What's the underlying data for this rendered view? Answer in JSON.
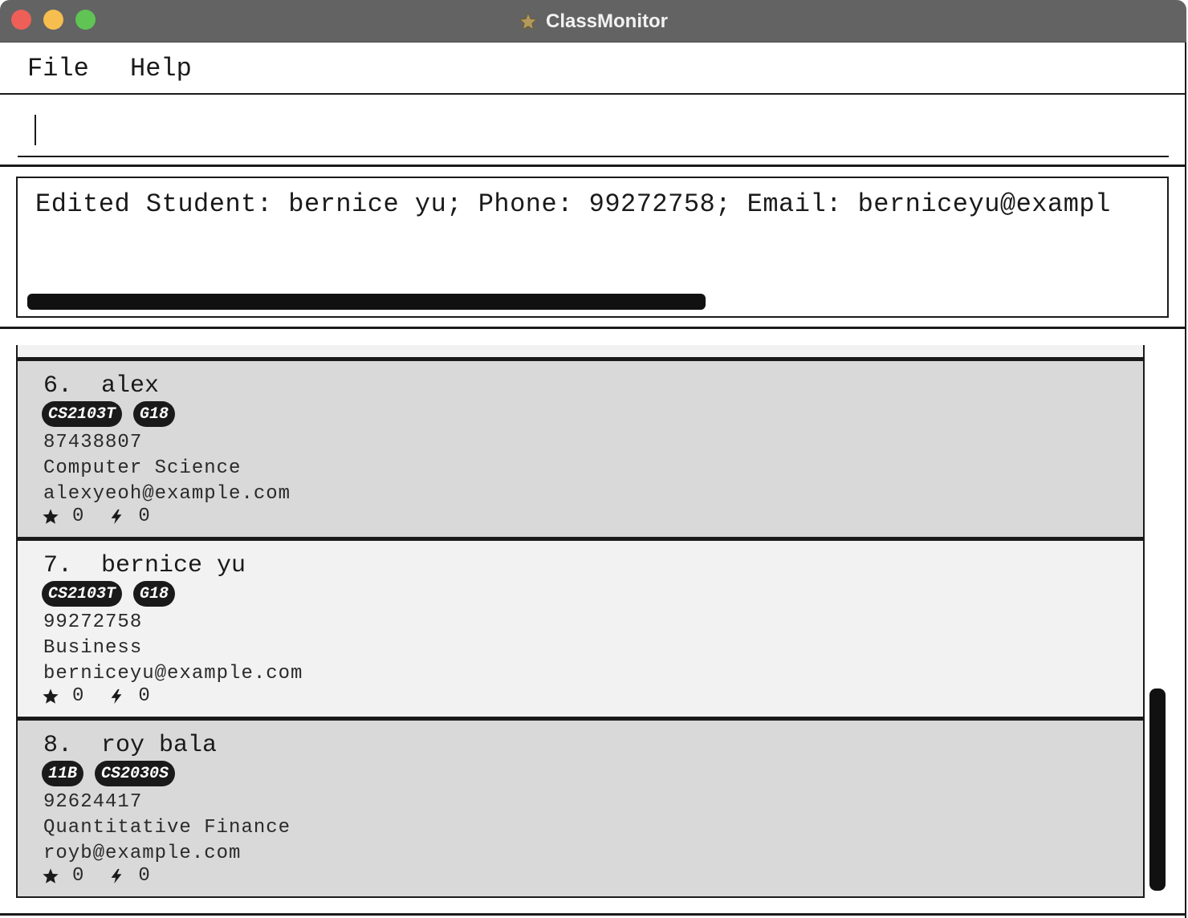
{
  "window": {
    "title": "ClassMonitor"
  },
  "menu": {
    "file": "File",
    "help": "Help"
  },
  "command": {
    "value": "",
    "placeholder": ""
  },
  "result": {
    "text": "Edited Student: bernice yu; Phone: 99272758; Email: berniceyu@exampl"
  },
  "students": [
    {
      "index_name": "6.  alex",
      "tags": [
        "CS2103T",
        "G18"
      ],
      "phone": "87438807",
      "course": "Computer Science",
      "email": "alexyeoh@example.com",
      "stars": "0",
      "bolts": "0"
    },
    {
      "index_name": "7.  bernice yu",
      "tags": [
        "CS2103T",
        "G18"
      ],
      "phone": "99272758",
      "course": "Business",
      "email": "berniceyu@example.com",
      "stars": "0",
      "bolts": "0"
    },
    {
      "index_name": "8.  roy bala",
      "tags": [
        "11B",
        "CS2030S"
      ],
      "phone": "92624417",
      "course": "Quantitative Finance",
      "email": "royb@example.com",
      "stars": "0",
      "bolts": "0"
    }
  ],
  "colors": {
    "titlebar": "#636363",
    "card_dark": "#d9d9d9",
    "card_light": "#f2f2f2",
    "tag_bg": "#1a1a1a",
    "title_star": "#b49a5a"
  },
  "icons": {
    "star": "star-icon",
    "bolt": "bolt-icon"
  }
}
